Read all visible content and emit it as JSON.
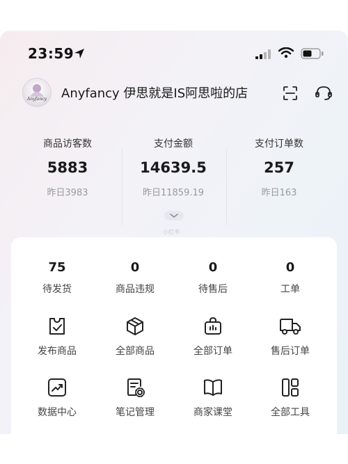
{
  "status_bar": {
    "time": "23:59"
  },
  "store": {
    "name": "Anyfancy 伊思就是IS阿思啦的店",
    "logo_text": "Anyfancy"
  },
  "metrics": [
    {
      "label": "商品访客数",
      "value": "5883",
      "prev": "昨日3983"
    },
    {
      "label": "支付金额",
      "value": "14639.5",
      "prev": "昨日11859.19"
    },
    {
      "label": "支付订单数",
      "value": "257",
      "prev": "昨日163"
    }
  ],
  "watermark": "小红书",
  "order_stats": [
    {
      "value": "75",
      "label": "待发货"
    },
    {
      "value": "0",
      "label": "商品违规"
    },
    {
      "value": "0",
      "label": "待售后"
    },
    {
      "value": "0",
      "label": "工单"
    }
  ],
  "tools": [
    {
      "label": "发布商品",
      "icon": "publish-product-icon"
    },
    {
      "label": "全部商品",
      "icon": "box-icon"
    },
    {
      "label": "全部订单",
      "icon": "shopping-bag-icon"
    },
    {
      "label": "售后订单",
      "icon": "truck-icon"
    },
    {
      "label": "数据中心",
      "icon": "trend-chart-icon"
    },
    {
      "label": "笔记管理",
      "icon": "note-settings-icon"
    },
    {
      "label": "商家课堂",
      "icon": "book-icon"
    },
    {
      "label": "全部工具",
      "icon": "grid-tools-icon"
    }
  ],
  "colors": {
    "text": "#1a1a1a",
    "muted": "#9a9a9a",
    "panel": "#ffffff"
  }
}
